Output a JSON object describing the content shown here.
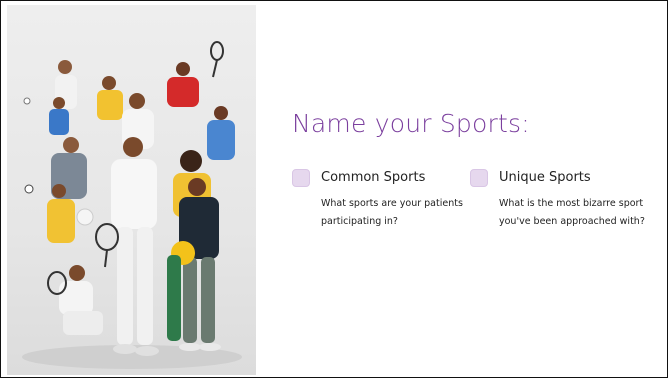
{
  "slide": {
    "title": "Name your Sports:",
    "image_description_icon": "sports-athletes-photo"
  },
  "topics": [
    {
      "label": "Common Sports",
      "body": "What sports are your patients participating in?",
      "checkbox_color": "#e6d8ee"
    },
    {
      "label": "Unique Sports",
      "body": "What is the most bizarre sport you've been approached with?",
      "checkbox_color": "#e6d8ee"
    }
  ],
  "colors": {
    "title": "#7b3f9e",
    "text": "#222222",
    "border": "#111111"
  }
}
